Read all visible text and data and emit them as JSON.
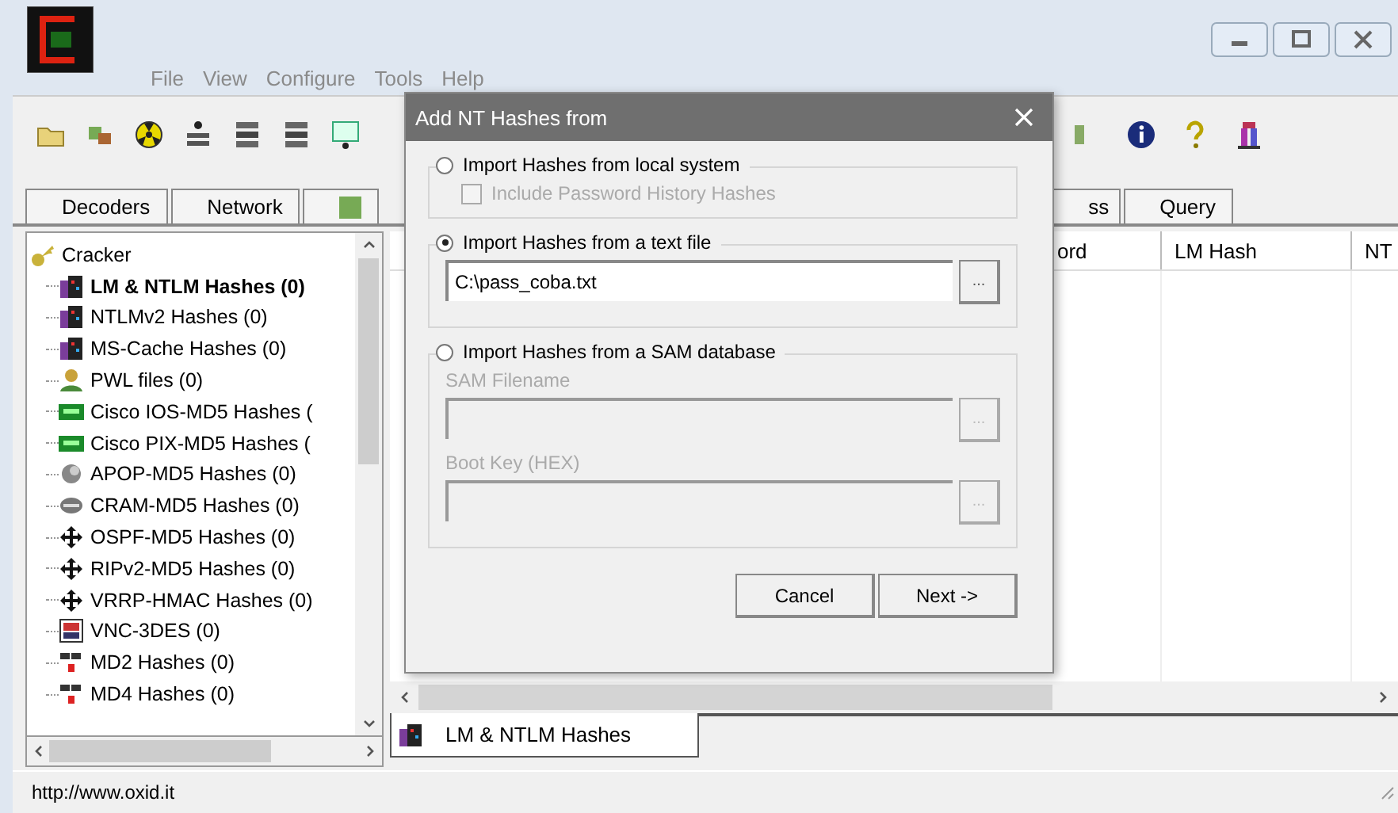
{
  "menu": [
    "File",
    "View",
    "Configure",
    "Tools",
    "Help"
  ],
  "toolbar": [
    {
      "kind": "folder"
    },
    {
      "kind": "network"
    },
    {
      "kind": "radiation"
    },
    {
      "kind": "auth"
    },
    {
      "kind": "reset"
    },
    {
      "kind": "ntlm"
    },
    {
      "kind": "monitor"
    }
  ],
  "toolbar_right": [
    {
      "kind": "partial"
    },
    {
      "kind": "info"
    },
    {
      "kind": "help"
    },
    {
      "kind": "person"
    }
  ],
  "tabs": [
    {
      "kind": "labeled",
      "label": "Decoders"
    },
    {
      "kind": "labeled",
      "label": "Network"
    },
    {
      "kind": "icon"
    }
  ],
  "tabs_right": [
    {
      "kind": "cut",
      "label": "ss"
    },
    {
      "kind": "labeled",
      "label": "Query"
    }
  ],
  "tree": {
    "label": "Cracker",
    "children": [
      {
        "label": "LM & NTLM Hashes (0)",
        "kind": "hash",
        "selected": true
      },
      {
        "label": "NTLMv2 Hashes (0)",
        "kind": "hash",
        "selected": false
      },
      {
        "label": "MS-Cache Hashes (0)",
        "kind": "hash",
        "selected": false
      },
      {
        "label": "PWL files (0)",
        "kind": "pwl",
        "selected": false
      },
      {
        "label": "Cisco IOS-MD5 Hashes (",
        "kind": "cisco",
        "selected": false
      },
      {
        "label": "Cisco PIX-MD5 Hashes (",
        "kind": "cisco",
        "selected": false
      },
      {
        "label": "APOP-MD5 Hashes (0)",
        "kind": "apop",
        "selected": false
      },
      {
        "label": "CRAM-MD5 Hashes (0)",
        "kind": "cram",
        "selected": false
      },
      {
        "label": "OSPF-MD5 Hashes (0)",
        "kind": "route",
        "selected": false
      },
      {
        "label": "RIPv2-MD5 Hashes (0)",
        "kind": "route",
        "selected": false
      },
      {
        "label": "VRRP-HMAC Hashes (0)",
        "kind": "route",
        "selected": false
      },
      {
        "label": "VNC-3DES (0)",
        "kind": "vnc",
        "selected": false
      },
      {
        "label": "MD2 Hashes (0)",
        "kind": "md",
        "selected": false
      },
      {
        "label": "MD4 Hashes (0)",
        "kind": "md",
        "selected": false
      }
    ]
  },
  "table": {
    "columns": [
      "ord",
      "LM Hash",
      "NT"
    ]
  },
  "bottom_tab": {
    "label": "LM & NTLM Hashes"
  },
  "status_bar": "http://www.oxid.it",
  "dialog": {
    "title": "Add NT Hashes from",
    "sections": [
      {
        "label": "Import Hashes from local system",
        "selected": false,
        "kind": "local",
        "checkbox": {
          "label": "Include Password History Hashes",
          "checked": false,
          "disabled": true
        }
      },
      {
        "label": "Import Hashes from a text file",
        "selected": true,
        "kind": "file",
        "fields": [
          {
            "value": "C:\\pass_coba.txt",
            "button": "...",
            "disabled": false
          }
        ]
      },
      {
        "label": "Import Hashes from a SAM database",
        "selected": false,
        "kind": "sam",
        "fields": [
          {
            "caption": "SAM Filename",
            "button": "...",
            "disabled": true
          },
          {
            "caption": "Boot Key (HEX)",
            "button": "...",
            "disabled": true
          }
        ]
      }
    ],
    "buttons": [
      "Cancel",
      "Next ->"
    ]
  }
}
